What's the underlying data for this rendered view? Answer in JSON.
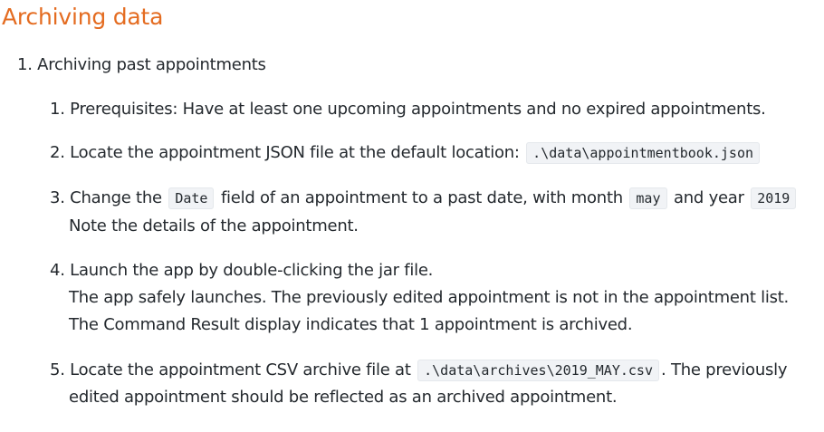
{
  "heading": "Archiving data",
  "outer_item": {
    "number": "1.",
    "text": "Archiving past appointments"
  },
  "steps": [
    {
      "number": "1.",
      "text": "Prerequisites: Have at least one upcoming appointments and no expired appointments."
    },
    {
      "number": "2.",
      "text": "Locate the appointment JSON file at the default location:",
      "code": ".\\data\\appointmentbook.json"
    },
    {
      "number": "3.",
      "text_a": "Change the",
      "code_a": "Date",
      "text_b": "field of an appointment to a past date, with month",
      "code_b": "may",
      "text_c": "and year",
      "code_c": "2019",
      "note": "Note the details of the appointment."
    },
    {
      "number": "4.",
      "line1": "Launch the app by double-clicking the jar file.",
      "line2": "The app safely launches. The previously edited appointment is not in the appointment list.",
      "line3": "The Command Result display indicates that 1 appointment is archived."
    },
    {
      "number": "5.",
      "text_a": "Locate the appointment CSV archive file at",
      "code": ".\\data\\archives\\2019_MAY.csv",
      "text_b": ". The previously",
      "line2": "edited appointment should be reflected as an archived appointment."
    }
  ]
}
